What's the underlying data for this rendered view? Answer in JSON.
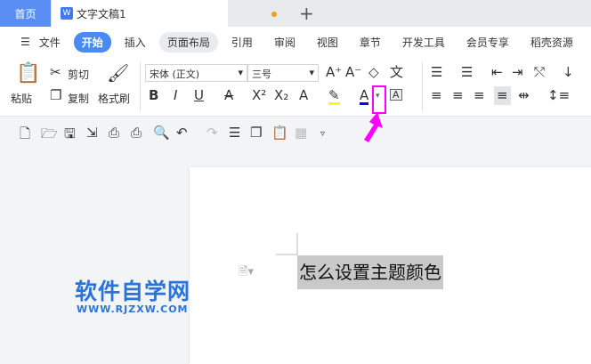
{
  "tabs": {
    "home": "首页",
    "doc": "文字文稿1",
    "doc_icon": "W",
    "new_tab": "+"
  },
  "menu": {
    "items": [
      "文件",
      "开始",
      "插入",
      "页面布局",
      "引用",
      "审阅",
      "视图",
      "章节",
      "开发工具",
      "会员专享",
      "稻壳资源"
    ]
  },
  "ribbon": {
    "paste": "粘贴",
    "cut": "剪切",
    "copy": "复制",
    "format_painter": "格式刷",
    "font_name": "宋体 (正文)",
    "font_size": "三号"
  },
  "document": {
    "text": "怎么设置主题颜色"
  },
  "watermark": {
    "title": "软件自学网",
    "url": "WWW.RJZXW.COM"
  },
  "colors": {
    "accent": "#4a8af4",
    "highlight_box": "#ff00ff",
    "font_color": "#0000ff",
    "highlight_color": "#ffff00"
  }
}
